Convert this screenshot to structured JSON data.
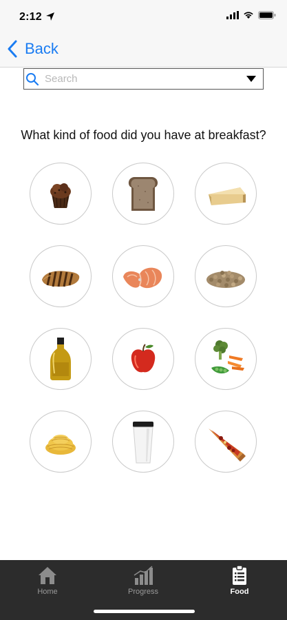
{
  "status_bar": {
    "time": "2:12"
  },
  "nav": {
    "back_label": "Back"
  },
  "search": {
    "placeholder": "Search",
    "value": ""
  },
  "question": "What kind of food did you have at breakfast?",
  "foods": [
    {
      "name": "muffin",
      "icon": "muffin-icon"
    },
    {
      "name": "bread",
      "icon": "bread-icon"
    },
    {
      "name": "cheese",
      "icon": "cheese-icon"
    },
    {
      "name": "chicken",
      "icon": "grilled-chicken-icon"
    },
    {
      "name": "salmon",
      "icon": "salmon-steak-icon"
    },
    {
      "name": "legumes",
      "icon": "lentils-icon"
    },
    {
      "name": "oil",
      "icon": "oil-bottle-icon"
    },
    {
      "name": "apple",
      "icon": "apple-icon"
    },
    {
      "name": "vegetables",
      "icon": "vegetables-icon"
    },
    {
      "name": "pasta",
      "icon": "pasta-icon"
    },
    {
      "name": "coffee",
      "icon": "coffee-cup-icon"
    },
    {
      "name": "pizza",
      "icon": "pizza-slice-icon"
    }
  ],
  "tabs": [
    {
      "label": "Home",
      "active": false
    },
    {
      "label": "Progress",
      "active": false
    },
    {
      "label": "Food",
      "active": true
    }
  ],
  "colors": {
    "accent": "#1a7cf2",
    "tab_bar": "#2c2c2c",
    "circle_border": "#c9c9c9"
  }
}
